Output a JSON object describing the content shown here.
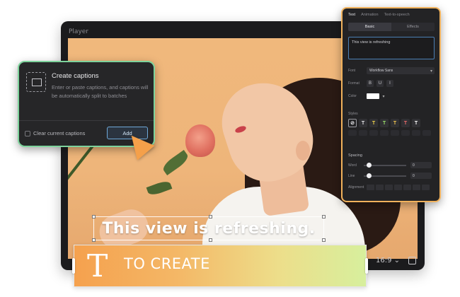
{
  "player": {
    "title": "Player",
    "aspect_ratio": "16:9 ⌄"
  },
  "caption_overlay": {
    "text": "This view is refreshing."
  },
  "create_captions_popup": {
    "title": "Create captions",
    "description": "Enter or paste captions, and captions will be automatically split to batches",
    "checkbox_label": "Clear current captions",
    "add_button": "Add",
    "accent_color": "#7ed39c"
  },
  "text_panel": {
    "accent_color": "#f1b25c",
    "tabs": [
      "Text",
      "Animation",
      "Text-to-speech"
    ],
    "segments": [
      "Basic",
      "Effects"
    ],
    "text_value": "This view is refreshing",
    "font_label": "Font",
    "font_value": "Workflow Sans",
    "format_label": "Format",
    "format_buttons": [
      "B",
      "U",
      "I"
    ],
    "color_label": "Color",
    "styles_label": "Styles",
    "style_presets": [
      "T",
      "T",
      "T",
      "T",
      "T",
      "T"
    ],
    "spacing_label": "Spacing",
    "word_label": "Word",
    "word_value": "0",
    "line_label": "Line",
    "line_value": "0",
    "alignment_label": "Alignment"
  },
  "banner": {
    "icon_glyph": "T",
    "text": "TO CREATE"
  }
}
